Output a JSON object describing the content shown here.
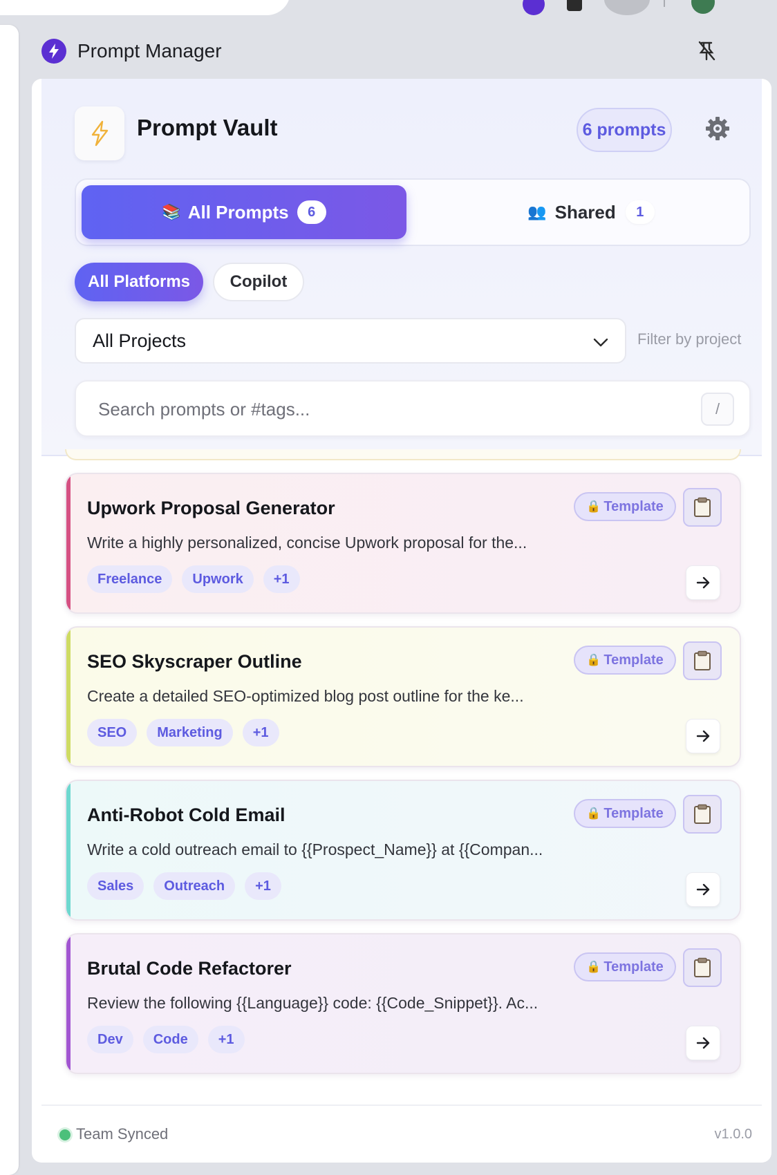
{
  "panel_header": {
    "title": "Prompt Manager"
  },
  "vault": {
    "logo_icon": "lightning-icon",
    "title": "Prompt Vault",
    "count_label": "6 prompts"
  },
  "tabs": [
    {
      "icon": "📚",
      "label": "All Prompts",
      "count": "6",
      "active": true
    },
    {
      "icon": "👥",
      "label": "Shared",
      "count": "1",
      "active": false
    }
  ],
  "platforms": [
    {
      "label": "All Platforms",
      "active": true
    },
    {
      "label": "Copilot",
      "active": false
    }
  ],
  "project_filter": {
    "selected": "All Projects",
    "hint": "Filter by project"
  },
  "search": {
    "placeholder": "Search prompts or #tags...",
    "shortcut": "/"
  },
  "prompts": [
    {
      "title": "Upwork Proposal Generator",
      "description": "Write a highly personalized, concise Upwork proposal for the...",
      "badge": "Template",
      "tags": [
        "Freelance",
        "Upwork",
        "+1"
      ],
      "accent": "#d55082"
    },
    {
      "title": "SEO Skyscraper Outline",
      "description": "Create a detailed SEO-optimized blog post outline for the ke...",
      "badge": "Template",
      "tags": [
        "SEO",
        "Marketing",
        "+1"
      ],
      "accent": "#cedb63"
    },
    {
      "title": "Anti-Robot Cold Email",
      "description": "Write a cold outreach email to {{Prospect_Name}} at {{Compan...",
      "badge": "Template",
      "tags": [
        "Sales",
        "Outreach",
        "+1"
      ],
      "accent": "#6ed8cf"
    },
    {
      "title": "Brutal Code Refactorer",
      "description": "Review the following {{Language}} code: {{Code_Snippet}}. Ac...",
      "badge": "Template",
      "tags": [
        "Dev",
        "Code",
        "+1"
      ],
      "accent": "#a155d1"
    }
  ],
  "footer": {
    "status": "Team Synced",
    "version": "v1.0.0"
  },
  "colors": {
    "accent": "#5d5be0",
    "primary_gradient_start": "#5f63f2",
    "primary_gradient_end": "#7b58e6",
    "status_green": "#4cc07b"
  }
}
